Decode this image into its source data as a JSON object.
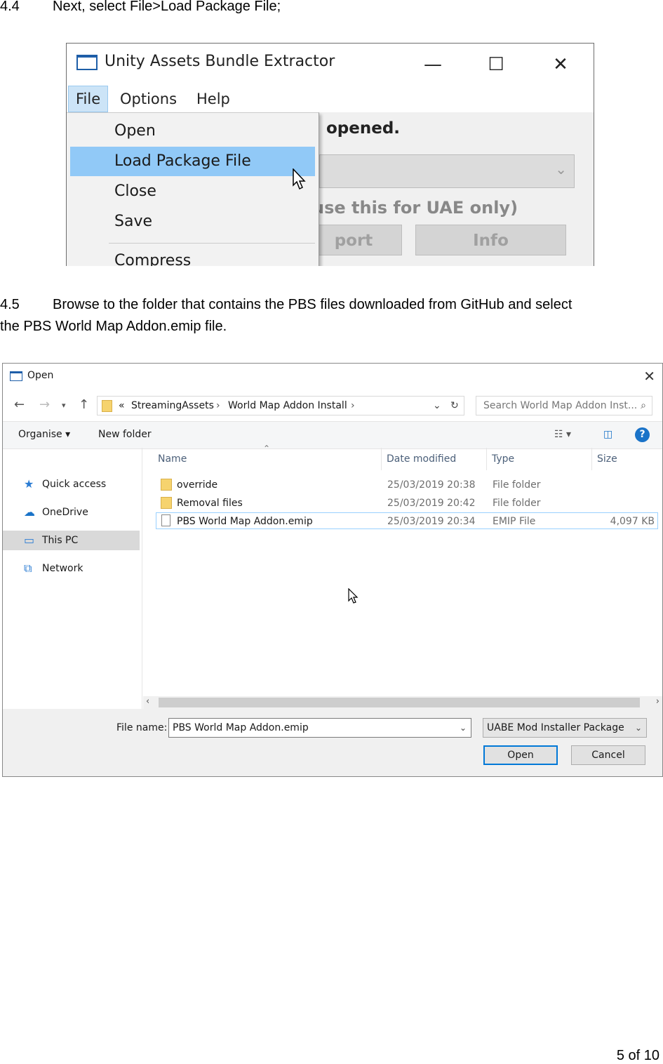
{
  "steps": [
    {
      "number": "4.4",
      "line1": "Next, select File>Load Package File;"
    },
    {
      "number": "4.5",
      "line1": "Browse to the folder that contains the PBS files downloaded from GitHub and select",
      "line2": "the PBS World Map Addon.emip file."
    }
  ],
  "uabe": {
    "title": "Unity Assets Bundle Extractor",
    "window_controls": {
      "minimize": "—",
      "maximize": "☐",
      "close": "✕"
    },
    "menus": [
      "File",
      "Options",
      "Help"
    ],
    "file_menu": [
      "Open",
      "Load Package File",
      "Close",
      "Save",
      "Compress"
    ],
    "highlighted_item": "Load Package File",
    "background": {
      "status_text": "opened.",
      "note_text": "use this for UAE only)",
      "buttons": [
        "port",
        "Info"
      ]
    }
  },
  "dialog": {
    "title": "Open",
    "address": {
      "overflow": "«",
      "crumbs": [
        "StreamingAssets",
        "World Map Addon Install"
      ]
    },
    "search_placeholder": "Search World Map Addon Inst...",
    "toolbar": {
      "organise": "Organise ▾",
      "new_folder": "New folder"
    },
    "nav_pane": [
      {
        "label": "Quick access",
        "icon": "star-icon"
      },
      {
        "label": "OneDrive",
        "icon": "cloud-icon"
      },
      {
        "label": "This PC",
        "icon": "computer-icon",
        "selected": true
      },
      {
        "label": "Network",
        "icon": "network-icon"
      }
    ],
    "columns": [
      "Name",
      "Date modified",
      "Type",
      "Size"
    ],
    "files": [
      {
        "name": "override",
        "date": "25/03/2019 20:38",
        "type": "File folder",
        "size": "",
        "kind": "folder"
      },
      {
        "name": "Removal files",
        "date": "25/03/2019 20:42",
        "type": "File folder",
        "size": "",
        "kind": "folder"
      },
      {
        "name": "PBS World Map Addon.emip",
        "date": "25/03/2019 20:34",
        "type": "EMIP File",
        "size": "4,097 KB",
        "kind": "file",
        "selected": true
      }
    ],
    "file_name_label": "File name:",
    "file_name_value": "PBS World Map Addon.emip",
    "file_type_value": "UABE Mod Installer Package",
    "open_button": "Open",
    "cancel_button": "Cancel"
  },
  "page_number": "5 of 10"
}
